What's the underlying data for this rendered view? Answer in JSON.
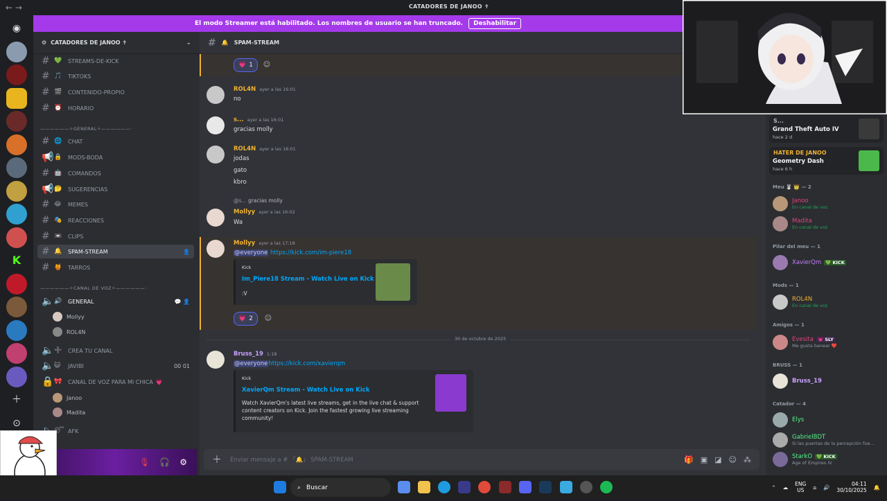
{
  "window": {
    "title": "CATADORES DE JANOO ✝",
    "nav_glyph": "←  →"
  },
  "banner": {
    "text": "El modo Streamer está habilitado. Los nombres de usuario se han truncado.",
    "button": "Deshabilitar"
  },
  "guild": {
    "name": "CATADORES DE JANOO ✝"
  },
  "channels": {
    "items": [
      {
        "name": "STREAMS-DE-KICK",
        "emoji": "💚"
      },
      {
        "name": "TIKTOKS",
        "emoji": "🎵"
      },
      {
        "name": "CONTENIDO-PROPIO",
        "emoji": "🎬"
      },
      {
        "name": "HORARIO",
        "emoji": "⏰"
      },
      {
        "name": "CHAT",
        "emoji": "🌐"
      },
      {
        "name": "MODS-BODA",
        "emoji": "🔒"
      },
      {
        "name": "COMANDOS",
        "emoji": "🤖"
      },
      {
        "name": "SUGERENCIAS",
        "emoji": "🤔"
      },
      {
        "name": "MEMES",
        "emoji": "😂"
      },
      {
        "name": "REACCIONES",
        "emoji": "🎭"
      },
      {
        "name": "CLIPS",
        "emoji": "📼"
      },
      {
        "name": "SPAM-STREAM",
        "emoji": "🔔"
      },
      {
        "name": "TARROS",
        "emoji": "🍯"
      }
    ],
    "category_general": "——————✧GENERAL✧——————·",
    "category_voice": "——————✧CANAL DE VOZ✧——————·",
    "voice": [
      {
        "name": "GENERAL",
        "emoji": "🔊"
      },
      {
        "name": "CREA TU CANAL",
        "emoji": "➕"
      },
      {
        "name": "JAVIBI",
        "emoji": "😺",
        "right": "00  01"
      },
      {
        "name": "CANAL DE VOZ PARA MI CHICA",
        "emoji": "🎀",
        "suffix": "💗"
      },
      {
        "name": "AFK",
        "emoji": "😴"
      }
    ],
    "voice_users_general": [
      "Mollyy",
      "ROL4N"
    ],
    "voice_users_chica": [
      "Janoo",
      "Madita"
    ]
  },
  "chat": {
    "channel": "SPAM-STREAM",
    "channel_emoji": "🔔",
    "messages": [
      {
        "author": "ROL4N",
        "time": "ayer a las 16:01",
        "lines": [
          "no"
        ]
      },
      {
        "author": "s...",
        "time": "ayer a las 16:01",
        "lines": [
          "gracias molly"
        ]
      },
      {
        "author": "ROL4N",
        "time": "ayer a las 16:01",
        "lines": [
          "jodas",
          "gato",
          "kbro"
        ]
      },
      {
        "author": "Mollyy",
        "time": "ayer a las 16:02",
        "reply_to": "@s...",
        "reply_text": "gracias molly",
        "lines": [
          "Wa"
        ]
      },
      {
        "author": "Mollyy",
        "time": "ayer a las 17:18",
        "mention": "@everyone",
        "link": "https://kick.com/im-piere18"
      },
      {
        "author": "Bruss_19",
        "time": "1:18",
        "mention": "@everyone",
        "link": "https://kick.com/xavierqm"
      }
    ],
    "reaction_top": {
      "emoji": "💗",
      "count": "1"
    },
    "reaction_mid": {
      "emoji": "💗",
      "count": "2"
    },
    "embed1": {
      "provider": "Kick",
      "title": "Im_Piere18 Stream - Watch Live on Kick",
      "desc": ":V"
    },
    "embed2": {
      "provider": "Kick",
      "title": "XavierQm Stream - Watch Live on Kick",
      "desc": "Watch XavierQm's latest live streams, get in the live chat & support content creators on Kick. Join the fastest growing live streaming community!"
    },
    "date_divider": "30 de octubre de 2025",
    "composer_placeholder": "Enviar mensaje a #  「🔔」 SPAM-STREAM"
  },
  "members": {
    "activities": [
      {
        "name": "S...",
        "game": "Grand Theft Auto IV",
        "time": "hace 2 d"
      },
      {
        "name": "HATER DE JANOO",
        "game": "Geometry Dash",
        "time": "hace 6 h"
      }
    ],
    "groups": [
      {
        "label": "Meu 🐰 👑 — 2",
        "members": [
          {
            "name": "Janoo",
            "status": "En canal de voz",
            "color": "#e0457b"
          },
          {
            "name": "Madita",
            "status": "En canal de voz",
            "color": "#e0457b"
          }
        ]
      },
      {
        "label": "Pilar del meu — 1",
        "members": [
          {
            "name": "XavierQm",
            "tag": "💚 KICK",
            "color": "#c77dff"
          }
        ]
      },
      {
        "label": "Mods — 1",
        "members": [
          {
            "name": "ROL4N",
            "status": "En canal de voz",
            "color": "#f0b232"
          }
        ]
      },
      {
        "label": "Amigos — 1",
        "members": [
          {
            "name": "Evesita",
            "tag": "💗 SLY",
            "status": "Me gusta banear ❤️",
            "color": "#e0457b"
          }
        ]
      },
      {
        "label": "BRUSS — 1",
        "members": [
          {
            "name": "Bruss_19",
            "color": "#c9a0ff"
          }
        ]
      },
      {
        "label": "Catador — 4",
        "members": [
          {
            "name": "Elys",
            "color": "#57f287"
          },
          {
            "name": "GabrielBDT",
            "status": "Si las puertas de la percepción fue...",
            "color": "#57f287"
          },
          {
            "name": "StarkO",
            "tag": "💚 KICK",
            "status": "Age of Empires IV",
            "color": "#57f287"
          }
        ]
      }
    ]
  },
  "taskbar": {
    "search": "Buscar",
    "lang": "ENG",
    "region": "US",
    "time": "04:11",
    "date": "30/10/2025"
  },
  "colors": {
    "accent": "#a43aea",
    "gold": "#f0b232",
    "link": "#00a8fc"
  }
}
